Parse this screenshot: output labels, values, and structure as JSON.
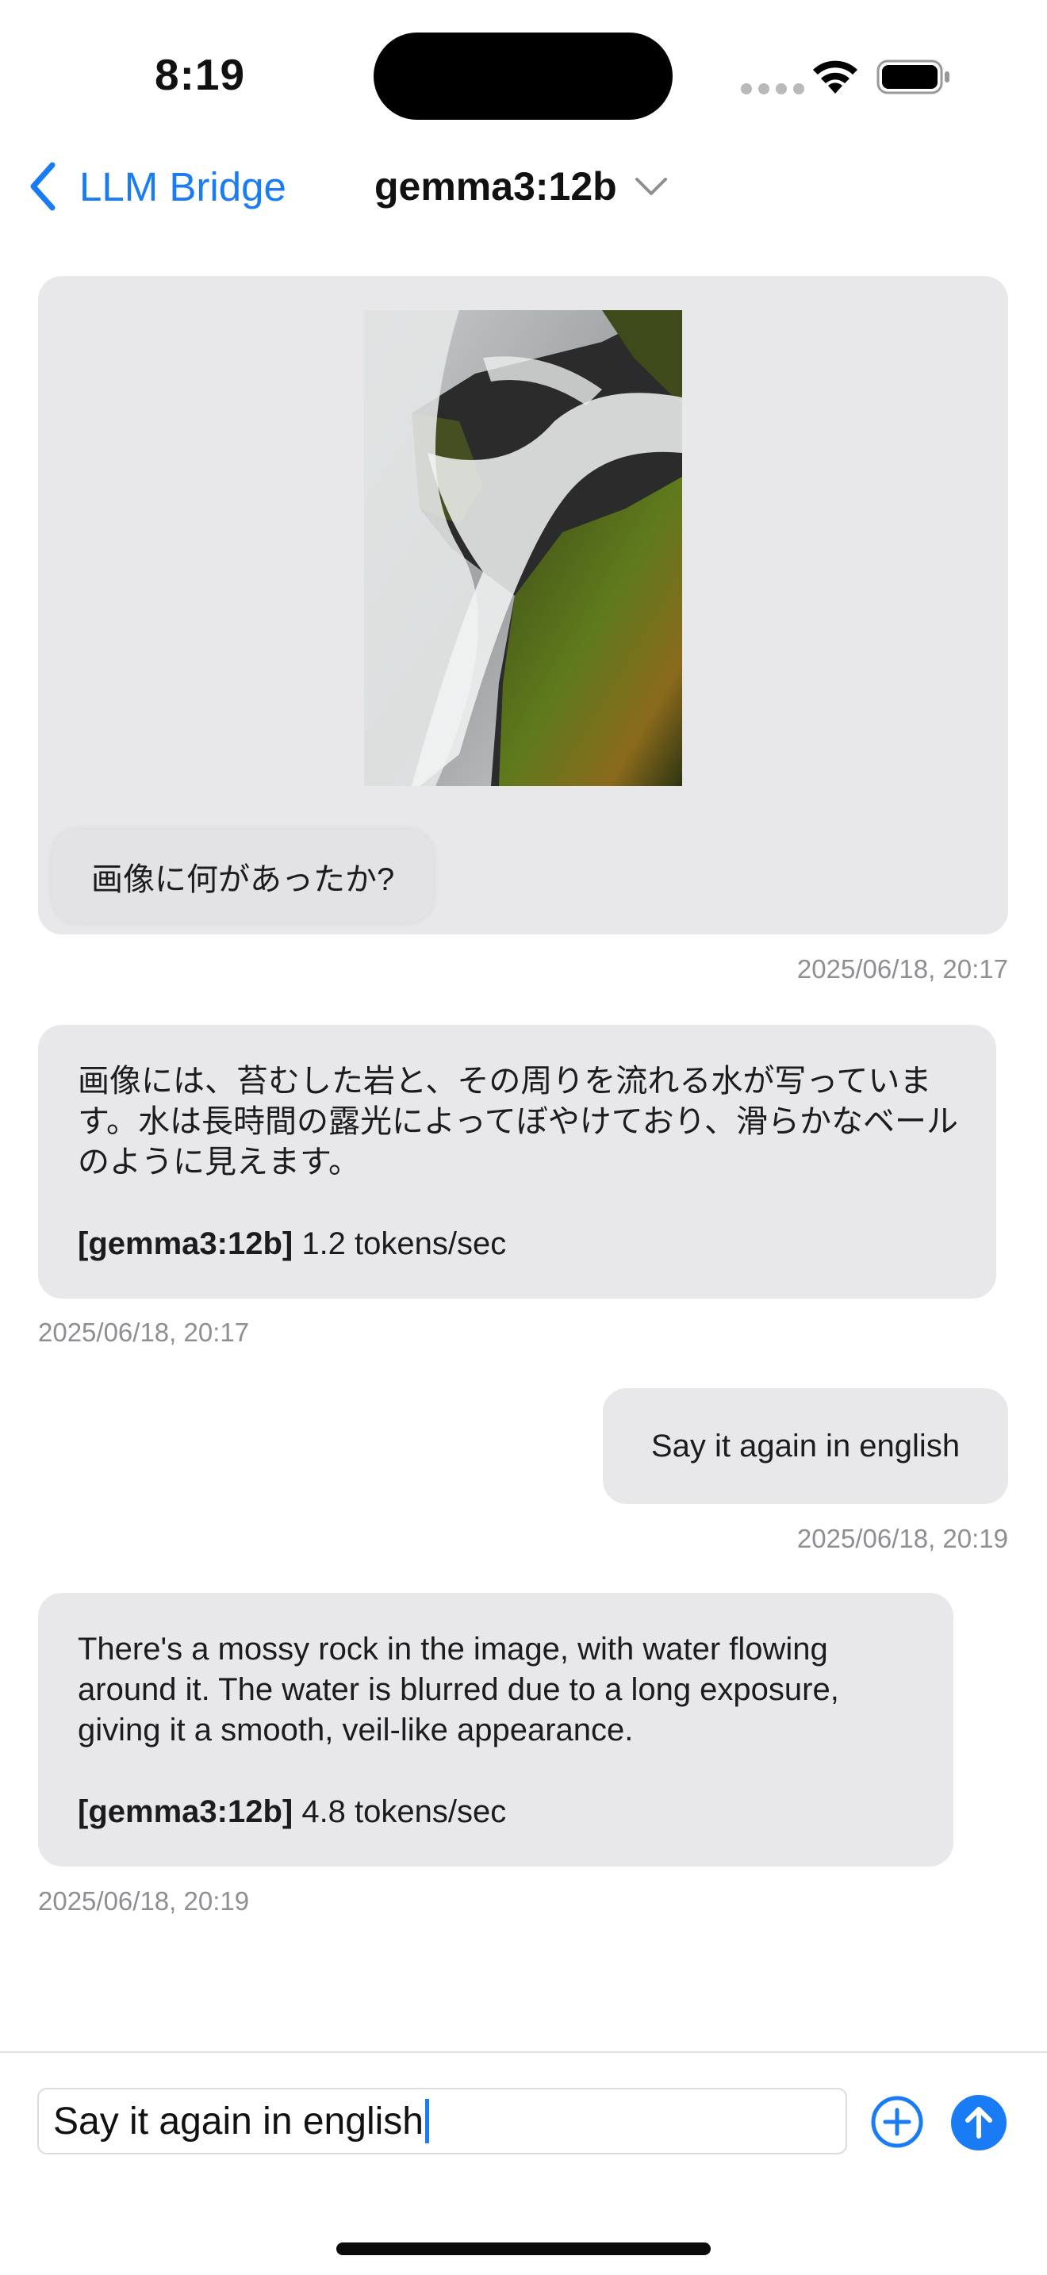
{
  "status_bar": {
    "time": "8:19"
  },
  "nav": {
    "back_label": "LLM Bridge",
    "model_name": "gemma3:12b"
  },
  "messages": {
    "image_question": "画像に何があったか?",
    "image_timestamp": "2025/06/18, 20:17",
    "reply1_text": "画像には、苔むした岩と、その周りを流れる水が写っています。水は長時間の露光によってぼやけており、滑らかなベールのように見えます。",
    "reply1_model": "[gemma3:12b]",
    "reply1_speed": " 1.2 tokens/sec",
    "reply1_timestamp": "2025/06/18, 20:17",
    "user2_text": "Say it again in english",
    "user2_timestamp": "2025/06/18, 20:19",
    "reply2_text": "There's a mossy rock in the image, with water flowing around it. The water is blurred due to a long exposure, giving it a smooth, veil-like appearance.",
    "reply2_model": "[gemma3:12b]",
    "reply2_speed": " 4.8 tokens/sec",
    "reply2_timestamp": "2025/06/18, 20:19"
  },
  "composer": {
    "value": "Say it again in english"
  },
  "icons": {
    "back": "chevron-left-icon",
    "model_menu": "chevron-down-icon",
    "attach": "plus-circle-icon",
    "send": "arrow-up-circle-icon"
  },
  "colors": {
    "accent": "#1a7cf5",
    "bubble": "#e8e8ea",
    "timestamp": "#8e8e93"
  }
}
